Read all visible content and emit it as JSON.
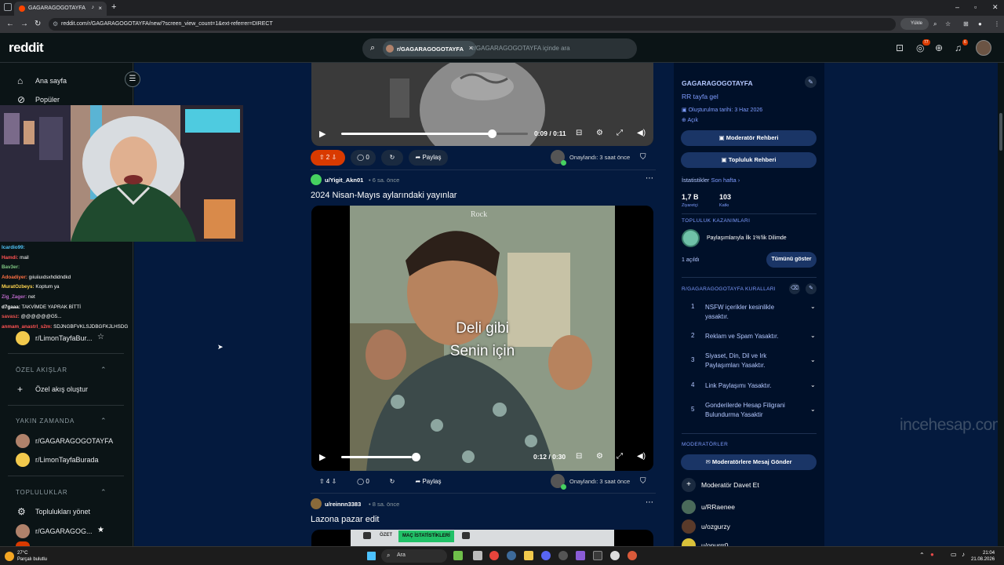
{
  "browser": {
    "tab_title": "GAGARAGOGOTAYFA",
    "url": "reddit.com/r/GAGARAGOGOTAYFA/new/?screen_view_count=1&ext-referrer=DIRECT",
    "yukle_label": "Yükle"
  },
  "header": {
    "logo": "reddit",
    "search_chip": "r/GAGARAGOGOTAYFA",
    "search_placeholder": "r/GAGARAGOGOTAYFA içinde ara",
    "chat_badge": "77",
    "notif_badge": "6"
  },
  "sidebar": {
    "home": "Ana sayfa",
    "popular": "Popüler",
    "fav_sub": "r/LimonTayfaBur...",
    "custom_feeds_header": "ÖZEL AKIŞLAR",
    "create_feed": "Özel akış oluştur",
    "recent_header": "YAKIN ZAMANDA",
    "recent": [
      "r/GAGARAGOGOTAYFA",
      "r/LimonTayfaBurada"
    ],
    "communities_header": "TOPLULUKLAR",
    "manage": "Toplulukları yönet",
    "community1": "r/GAGARAGOG..."
  },
  "chat": [
    {
      "user": "Icardio99:",
      "msg": "",
      "color": "#4fc3f7"
    },
    {
      "user": "Hamdi:",
      "msg": "mail",
      "color": "#ff5252"
    },
    {
      "user": "Bav3er:",
      "msg": "",
      "color": "#81c784"
    },
    {
      "user": "Adoadiyer:",
      "msg": "gıiuiiuıdsxhdidndkd",
      "color": "#ff7043"
    },
    {
      "user": "MuratOzbeys:",
      "msg": "Koptum ya",
      "color": "#ffd54f"
    },
    {
      "user": "Zig_Zager:",
      "msg": "net",
      "color": "#ba68c8"
    },
    {
      "user": "d7gaaa:",
      "msg": "TAKVİMDE YAPRAK BİTTİ",
      "color": "#ffffff"
    },
    {
      "user": "savasz:",
      "msg": "@@@@@@G5...",
      "color": "#ef5350"
    },
    {
      "user": "anmam_anastrl_s2m:",
      "msg": "SDJNGBFVKLSJDBGFKJLHSDG",
      "color": "#ff5252"
    }
  ],
  "posts": [
    {
      "votes": "2",
      "comments": "0",
      "share": "Paylaş",
      "time": "0:09 / 0:11",
      "approved": "Onaylandı: 3 saat önce"
    },
    {
      "user": "u/Yigit_Akn01",
      "ago": "• 6 sa. önce",
      "title": "2024 Nisan-Mayıs aylarındaki yayınlar",
      "caption1": "Deli gibi",
      "caption2": "Senin için",
      "brand": "Rock",
      "votes": "4",
      "comments": "0",
      "share": "Paylaş",
      "time": "0:12 / 0:30",
      "approved": "Onaylandı: 3 saat önce"
    },
    {
      "user": "u/reinnn3383",
      "ago": "• 8 sa. önce",
      "title": "Lazona pazar edit",
      "tab_ozet": "ÖZET",
      "tab_mac": "MAÇ İSTATİSTİKLERİ"
    }
  ],
  "community": {
    "name": "GAGARAGOGOTAYFA",
    "desc": "RR tayfa gel",
    "created": "Oluşturulma tarihi: 3 Haz 2026",
    "visibility": "Açık",
    "mod_guide": "Moderatör Rehberi",
    "community_guide": "Topluluk Rehberi",
    "stats_label": "İstatistikler",
    "stats_range": "Son hafta ›",
    "visitors": "1,7 B",
    "visitors_label": "Ziyaretçi",
    "contributions": "103",
    "contributions_label": "Katkı",
    "achievements_header": "TOPLULUK KAZANIMLARI",
    "achievement": "Paylaşımlarıyla İlk 1%'lik Dilimde",
    "unlocked": "1 açıldı",
    "show_all": "Tümünü göster",
    "rules_header": "R/GAGARAGOGOTAYFA KURALLARI",
    "rules": [
      "NSFW içerikler kesinlikle yasaktır.",
      "Reklam ve Spam Yasaktır.",
      "Siyaset, Din, Dil ve Irk Paylaşımları Yasaktır.",
      "Link Paylaşımı Yasaktır.",
      "Gonderilerde Hesap Filigrani Bulundurma Yasaktir"
    ],
    "mods_header": "MODERATÖRLER",
    "msg_mods": "Moderatörlere Mesaj Gönder",
    "invite_mod": "Moderatör Davet Et",
    "mods": [
      "u/RRaenee",
      "u/ozgurzy",
      "u/onurrr0"
    ]
  },
  "watermark": "incehesap.com",
  "taskbar": {
    "temp": "27°C",
    "weather": "Parçalı bulutlu",
    "search": "Ara",
    "time": "21:04",
    "date": "21.08.2026"
  }
}
